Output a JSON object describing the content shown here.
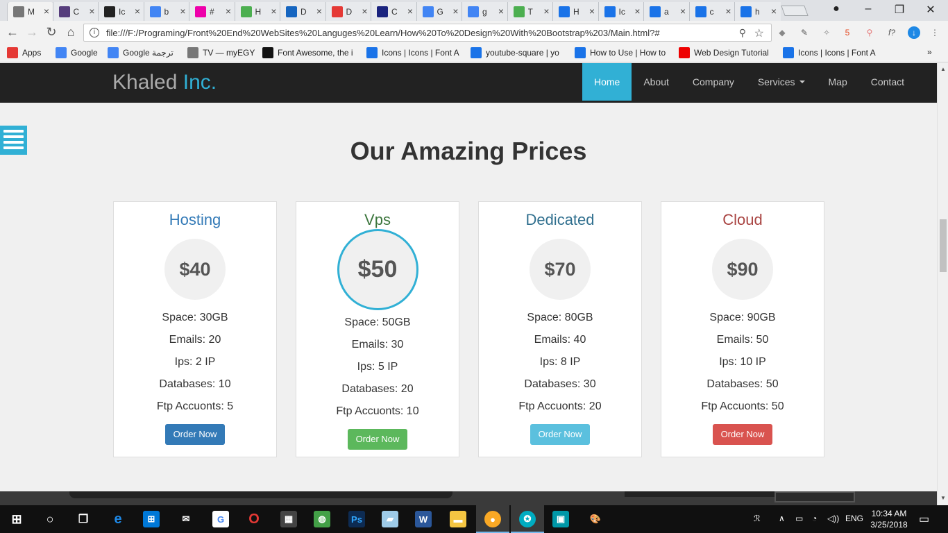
{
  "browser": {
    "tabs": [
      {
        "title": "M",
        "favicon": "page-icon",
        "color": "#777"
      },
      {
        "title": "C",
        "favicon": "bootstrap-icon",
        "color": "#563d7c"
      },
      {
        "title": "Ic",
        "favicon": "github-icon",
        "color": "#222"
      },
      {
        "title": "b",
        "favicon": "google-icon",
        "color": "#4285f4"
      },
      {
        "title": "#",
        "favicon": "hex-icon",
        "color": "#e0a"
      },
      {
        "title": "H",
        "favicon": "w3-icon",
        "color": "#4caf50"
      },
      {
        "title": "D",
        "favicon": "globe-icon",
        "color": "#1565c0"
      },
      {
        "title": "D",
        "favicon": "font-icon",
        "color": "#e53935"
      },
      {
        "title": "C",
        "favicon": "dans-tools-icon",
        "color": "#1a237e"
      },
      {
        "title": "G",
        "favicon": "google-icon",
        "color": "#4285f4"
      },
      {
        "title": "g",
        "favicon": "google-icon",
        "color": "#4285f4"
      },
      {
        "title": "T",
        "favicon": "w3-icon",
        "color": "#4caf50"
      },
      {
        "title": "H",
        "favicon": "flag-icon",
        "color": "#1a73e8"
      },
      {
        "title": "Ic",
        "favicon": "flag-icon",
        "color": "#1a73e8"
      },
      {
        "title": "a",
        "favicon": "flag-icon",
        "color": "#1a73e8"
      },
      {
        "title": "c",
        "favicon": "flag-icon",
        "color": "#1a73e8"
      },
      {
        "title": "h",
        "favicon": "flag-icon",
        "color": "#1a73e8"
      }
    ],
    "url": "file:///F:/Programing/Front%20End%20WebSites%20Languges%20Learn/How%20To%20Design%20With%20Bootstrap%203/Main.html?#",
    "bookmarks": [
      {
        "label": "Apps",
        "icon": "apps-grid-icon"
      },
      {
        "label": "Google",
        "icon": "google-icon"
      },
      {
        "label": "Google ترجمة",
        "icon": "translate-icon"
      },
      {
        "label": "TV — myEGY",
        "icon": "page-icon"
      },
      {
        "label": "Font Awesome, the i",
        "icon": "font-awesome-flag-icon"
      },
      {
        "label": "Icons | Icons | Font A",
        "icon": "flag-icon"
      },
      {
        "label": "youtube-square | yo",
        "icon": "flag-icon"
      },
      {
        "label": "How to Use | How to",
        "icon": "flag-icon"
      },
      {
        "label": "Web Design Tutorial",
        "icon": "youtube-icon"
      },
      {
        "label": "Icons | Icons | Font A",
        "icon": "flag-icon"
      }
    ],
    "more_bookmarks": "»"
  },
  "site": {
    "brand": "Khaled",
    "brand_accent": "Inc.",
    "nav": [
      {
        "label": "Home",
        "active": true
      },
      {
        "label": "About"
      },
      {
        "label": "Company"
      },
      {
        "label": "Services",
        "dropdown": true
      },
      {
        "label": "Map"
      },
      {
        "label": "Contact"
      }
    ],
    "section_title": "Our Amazing Prices",
    "plans": [
      {
        "name": "Hosting",
        "price": "$40",
        "name_color": "#337ab7",
        "button_color": "#337ab7",
        "features": [
          "Space: 30GB",
          "Emails: 20",
          "Ips: 2 IP",
          "Databases: 10",
          "Ftp Accuonts: 5"
        ],
        "button": "Order Now"
      },
      {
        "name": "Vps",
        "price": "$50",
        "name_color": "#3c763d",
        "button_color": "#5cb85c",
        "featured": true,
        "features": [
          "Space: 50GB",
          "Emails: 30",
          "Ips: 5 IP",
          "Databases: 20",
          "Ftp Accuonts: 10"
        ],
        "button": "Order Now"
      },
      {
        "name": "Dedicated",
        "price": "$70",
        "name_color": "#31708f",
        "button_color": "#5bc0de",
        "features": [
          "Space: 80GB",
          "Emails: 40",
          "Ips: 8 IP",
          "Databases: 30",
          "Ftp Accuonts: 20"
        ],
        "button": "Order Now"
      },
      {
        "name": "Cloud",
        "price": "$90",
        "name_color": "#a94442",
        "button_color": "#d9534f",
        "features": [
          "Space: 90GB",
          "Emails: 50",
          "Ips: 10 IP",
          "Databases: 50",
          "Ftp Accuonts: 50"
        ],
        "button": "Order Now"
      }
    ]
  },
  "taskbar": {
    "language": "ENG",
    "time": "10:34 AM",
    "date": "3/25/2018"
  }
}
